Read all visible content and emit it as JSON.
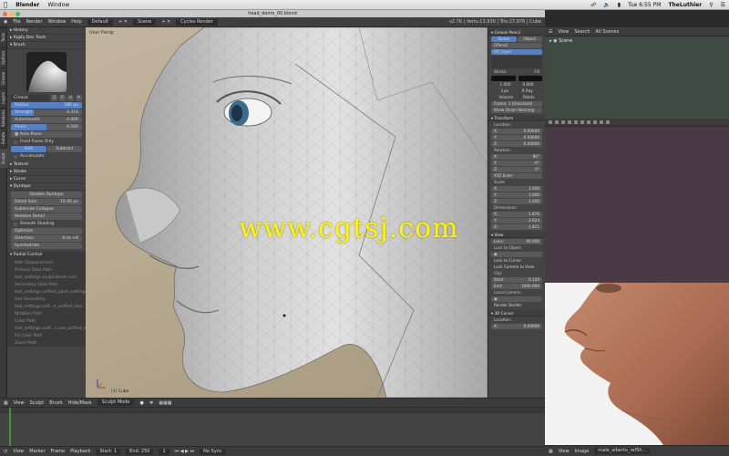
{
  "mac_menu": {
    "apple": "",
    "app": "Blender",
    "window": "Window",
    "clock": "Tue 6:55 PM",
    "user": "TheLuthier"
  },
  "window_title": "head_demo_00.blend",
  "topbar": {
    "file": "File",
    "render": "Render",
    "window": "Window",
    "help": "Help",
    "layout": "Default",
    "scene": "Scene",
    "engine": "Cycles Render",
    "info": "v2.76 | Verts:13,930 | Tris:27,976 | Cube"
  },
  "side_tabs": [
    "Tools",
    "Options",
    "Grease Pencil",
    "Layers",
    "Relations",
    "Rotate Tools",
    "Sculpt"
  ],
  "tool_panel": {
    "history": "History",
    "rigify": "Rigify Dev Tools",
    "brush": "Brush",
    "brush_name": "Crease",
    "brush_users": "2",
    "brush_f": "F",
    "radius_label": "Radius:",
    "radius": "180 px",
    "strength_label": "Strength:",
    "strength": "0.316",
    "autosmooth_label": "Autosmooth:",
    "autosmooth": "0.000",
    "pinch_label": "Pinch:",
    "pinch": "0.500",
    "area_plane": "Area Plane",
    "front_faces": "Front Faces Only",
    "add": "Add",
    "subtract": "Subtract",
    "accumulate": "Accumulate",
    "texture": "Texture",
    "stroke": "Stroke",
    "curve": "Curve",
    "dyntopo": "Dyntopo",
    "disable_dyntopo": "Disable Dyntopo",
    "detail_label": "Detail Size:",
    "detail": "10.00 px",
    "subdivide": "Subdivide Collapse",
    "relative": "Relative Detail",
    "smooth_shading": "Smooth Shading",
    "optimize": "Optimize",
    "direction_label": "Direction:",
    "direction": "-X to +X",
    "symmetrize": "Symmetrize",
    "radial": "Radial Control",
    "redo": [
      "Radial Control",
      "Path Displacement",
      "Primary Data Path",
      "tool_settings.sculpt.brush.size",
      "Secondary Data Path",
      "tool_settings.unified_paint_settings...",
      "Use Secondary",
      "tool_settings.unif...e_unified_size",
      "Rotation Path",
      "Color Path",
      "tool_settings.unifi...s.use_unified_size",
      "Fill Color Path",
      "Zoom Path"
    ]
  },
  "viewport": {
    "title": "User Persp",
    "object": "(1) Cube",
    "watermark": "www.cgtsj.com"
  },
  "viewbar": {
    "view": "View",
    "sculpt": "Sculpt",
    "brush": "Brush",
    "hidemask": "Hide/Mask",
    "mode": "Sculpt Mode"
  },
  "timeline": {
    "view": "View",
    "marker": "Marker",
    "frame": "Frame",
    "playback": "Playback",
    "start_label": "Start:",
    "start": "1",
    "end_label": "End:",
    "end": "250",
    "current": "1",
    "sync": "No Sync"
  },
  "props": {
    "grease": "Grease Pencil",
    "scene_btn": "Scene",
    "object_btn": "Object",
    "gpencil": "GPencil",
    "layer": "GP_Layer",
    "stroke": "Stroke",
    "fill": "Fill",
    "s1": "1.000",
    "s2": "0.000",
    "volume": "Volume",
    "points": "Points",
    "thickness": "3 px",
    "xray": "X Ray",
    "frame_label": "Frame: 1 (Unlocked)",
    "show_onion": "Show Onion Skinning",
    "transform": "Transform",
    "location": "Location:",
    "lx": "0.00000",
    "ly": "0.00000",
    "lz": "0.00000",
    "rotation": "Rotation:",
    "rx": "90°",
    "ry": "-0°",
    "rz": "0°",
    "xyz": "XYZ Euler",
    "scale": "Scale:",
    "sx": "1.000",
    "sy": "1.000",
    "sz": "1.000",
    "dimensions": "Dimensions:",
    "dx": "1.876",
    "dy": "2.624",
    "dz": "1.811",
    "view": "View",
    "lens_label": "Lens:",
    "lens": "60.000",
    "lock_obj": "Lock to Object",
    "lock_cursor": "Lock to Cursor",
    "lock_cam": "Lock Camera to View",
    "clip": "Clip:",
    "start_label": "Start:",
    "clip_start": "0.100",
    "end_label": "End:",
    "clip_end": "1000.000",
    "local_cam": "Local Camera:",
    "render_border": "Render Border",
    "cursor3d": "3D Cursor",
    "cloc": "Location:",
    "cx": "0.00000"
  },
  "outliner": {
    "view": "View",
    "search": "Search",
    "filter": "All Scenes",
    "scene": "Scene"
  },
  "imgbar": {
    "view": "View",
    "image": "Image",
    "file": "male_alberto_refSh..."
  }
}
